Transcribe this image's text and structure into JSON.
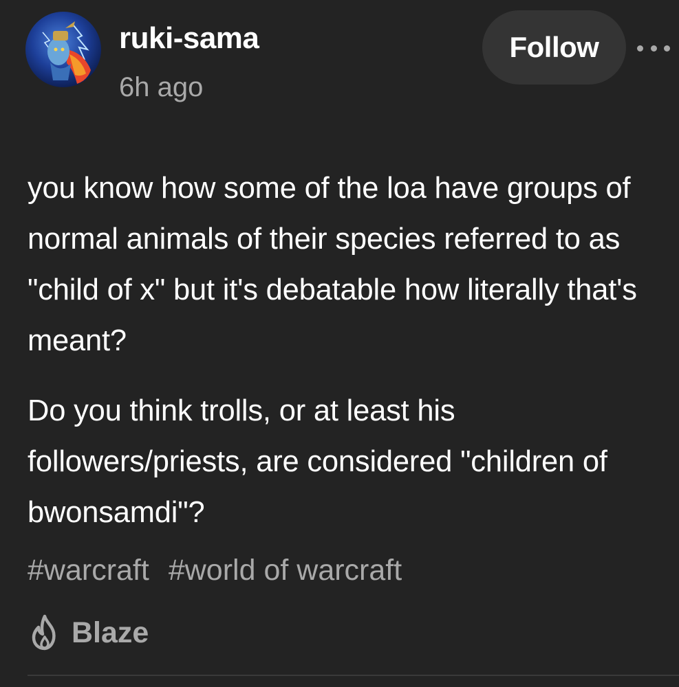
{
  "post": {
    "author": {
      "username": "ruki-sama",
      "timestamp": "6h ago",
      "avatar_icon": "avatar-troll-character"
    },
    "follow_label": "Follow",
    "more_icon": "ellipsis-icon",
    "paragraphs": [
      "you know how some of the loa have groups of normal animals of their species referred to as \"child of x\" but it's debatable how literally that's meant?",
      "Do you think trolls, or at least his followers/priests, are considered \"children of bwonsamdi\"?"
    ],
    "tags": [
      "#warcraft",
      "#world of warcraft"
    ],
    "blaze": {
      "label": "Blaze",
      "icon": "flame-icon"
    }
  },
  "colors": {
    "background": "#232323",
    "text_primary": "#ffffff",
    "text_secondary": "#a9a9a9",
    "button_bg": "#343434"
  }
}
